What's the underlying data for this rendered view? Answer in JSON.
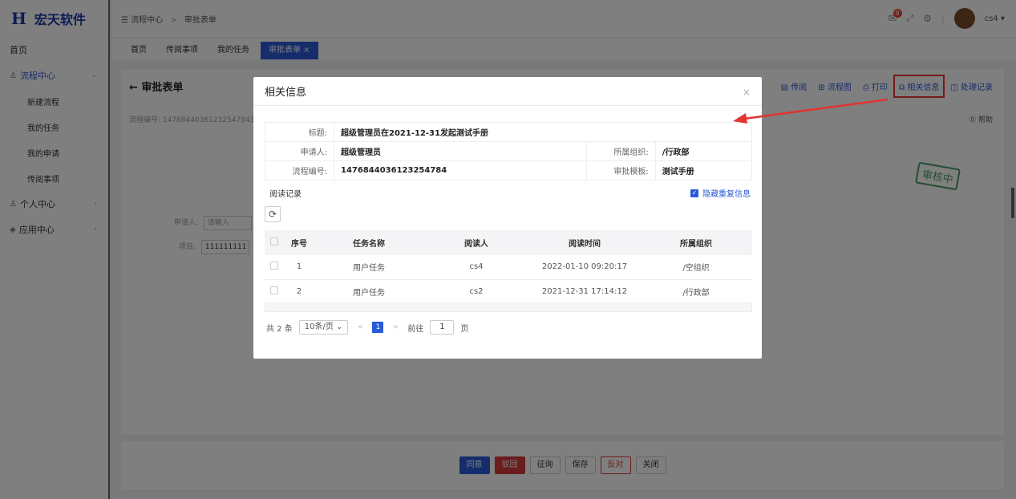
{
  "logo": {
    "mark": "H",
    "text": "宏天软件"
  },
  "breadcrumb": {
    "root": "流程中心",
    "sep": ">",
    "current": "审批表单"
  },
  "user": {
    "badge_count": "9",
    "name": "cs4 ▾"
  },
  "sidebar": {
    "home": "首页",
    "flow_center": "流程中心",
    "flow_items": [
      "新建流程",
      "我的任务",
      "我的申请",
      "传阅事项"
    ],
    "personal_center": "个人中心",
    "app_center": "应用中心"
  },
  "tabs": [
    "首页",
    "传阅事项",
    "我的任务",
    "审批表单 ×"
  ],
  "main": {
    "title": "← 审批表单",
    "flow_no_label": "流程编号: 14768440361232547843",
    "applicant_label": "申请人:",
    "applicant_placeholder": "请输入",
    "project_label": "项目:",
    "project_value": "111111111",
    "help": "⓪ 帮助",
    "stamp": "审核中",
    "toolbar": [
      "传阅",
      "流程图",
      "打印",
      "相关信息",
      "处理记录"
    ]
  },
  "buttons": {
    "agree": "同意",
    "reject": "驳回",
    "consult": "征询",
    "save": "保存",
    "oppose": "反对",
    "close": "关闭"
  },
  "modal": {
    "title": "相关信息",
    "close": "×",
    "info": {
      "title_label": "标题:",
      "title_value": "超级管理员在2021-12-31发起测试手册",
      "applicant_label": "申请人:",
      "applicant_value": "超级管理员",
      "org_label": "所属组织:",
      "org_value": "/行政部",
      "flow_no_label": "流程编号:",
      "flow_no_value": "1476844036123254784",
      "template_label": "审批模板:",
      "template_value": "测试手册"
    },
    "read_records_title": "阅读记录",
    "hide_duplicate": "隐藏重复信息",
    "refresh_icon": "⟳",
    "columns": [
      "序号",
      "任务名称",
      "阅读人",
      "阅读时间",
      "所属组织"
    ],
    "rows": [
      [
        "1",
        "用户任务",
        "cs4",
        "2022-01-10 09:20:17",
        "/空组织"
      ],
      [
        "2",
        "用户任务",
        "cs2",
        "2021-12-31 17:14:12",
        "/行政部"
      ]
    ],
    "pager": {
      "total": "共 2 条",
      "page_size": "10条/页",
      "prev": "<",
      "current": "1",
      "next": ">",
      "goto_label": "前往",
      "goto_value": "1",
      "page_suffix": "页"
    }
  },
  "colors": {
    "accent": "#2a5bd7",
    "danger": "#d73838",
    "annotation": "#e33333"
  }
}
